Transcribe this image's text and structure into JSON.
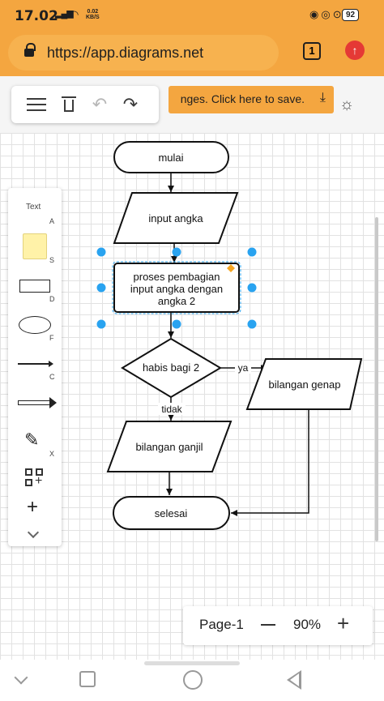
{
  "status_bar": {
    "time": "17.02",
    "network_speed_value": "0.02",
    "network_speed_unit": "KB/S",
    "battery": "92",
    "icons": [
      "signal-icon",
      "wifi-icon",
      "alarm-icon",
      "lock-icon",
      "nfc-icon",
      "battery-icon"
    ]
  },
  "browser": {
    "url": "https://app.diagrams.net",
    "tab_count": "1",
    "icons": [
      "lock-icon",
      "update-icon"
    ]
  },
  "toolbar": {
    "icons": [
      "menu-icon",
      "delete-icon",
      "undo-icon",
      "redo-icon"
    ],
    "save_banner": "nges. Click here to save.",
    "icons_right": [
      "download-icon",
      "brightness-icon"
    ]
  },
  "shapes_panel": {
    "text_label": "Text",
    "keys": [
      "A",
      "S",
      "D",
      "F",
      "C",
      "X"
    ],
    "items": [
      "text",
      "note",
      "rectangle",
      "ellipse",
      "line",
      "arrow",
      "freehand-icon",
      "add-shape-icon",
      "plus-icon",
      "chevron-down-icon"
    ]
  },
  "diagram": {
    "nodes": {
      "start": "mulai",
      "input": "input angka",
      "process_line1": "proses pembagian",
      "process_line2": "input angka dengan",
      "process_line3": "angka 2",
      "decision": "habis bagi 2",
      "output_even": "bilangan genap",
      "output_odd": "bilangan ganjil",
      "end": "selesai"
    },
    "edge_labels": {
      "yes": "ya",
      "no": "tidak"
    },
    "colors": {
      "selection": "#29a3f0",
      "handle": "#f5a623"
    }
  },
  "page_panel": {
    "page": "Page-1",
    "zoom": "90%"
  },
  "colors": {
    "accent": "#f4a640",
    "update": "#e53935"
  }
}
